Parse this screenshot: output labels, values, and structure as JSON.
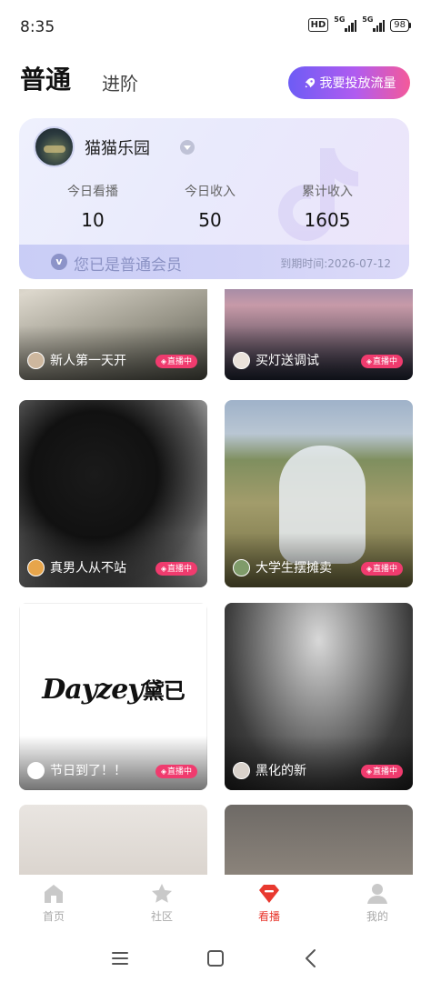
{
  "status": {
    "time": "8:35",
    "hd": "HD",
    "net1": "5G",
    "net2": "5G",
    "battery": "98"
  },
  "header": {
    "tab_normal": "普通",
    "tab_advanced": "进阶",
    "cta_label": "我要投放流量"
  },
  "profile": {
    "name": "猫猫乐园"
  },
  "stats": [
    {
      "label": "今日看播",
      "value": "10"
    },
    {
      "label": "今日收入",
      "value": "50"
    },
    {
      "label": "累计收入",
      "value": "1605"
    }
  ],
  "membership": {
    "icon_letter": "v",
    "status_text": "您已是普通会员",
    "expiry_text": "到期时间:2026-07-12"
  },
  "feed": {
    "live_label": "直播中",
    "logo_text": "Dayzey",
    "logo_cn": "黛已",
    "cards": [
      {
        "title": "新人第一天开"
      },
      {
        "title": "买灯送调试"
      },
      {
        "title": "真男人从不站"
      },
      {
        "title": "大学生摆摊卖"
      },
      {
        "title": "节日到了！！"
      },
      {
        "title": "黑化的新"
      },
      {
        "title": ""
      },
      {
        "title": ""
      }
    ]
  },
  "tabbar": [
    {
      "label": "首页",
      "icon": "home-icon"
    },
    {
      "label": "社区",
      "icon": "star-icon"
    },
    {
      "label": "看播",
      "icon": "watch-live-icon",
      "active": true
    },
    {
      "label": "我的",
      "icon": "profile-icon"
    }
  ],
  "colors": {
    "accent": "#e8392f",
    "live_badge": "#f03b6e",
    "cta_start": "#6d5cf5",
    "cta_end": "#f45a9a"
  }
}
